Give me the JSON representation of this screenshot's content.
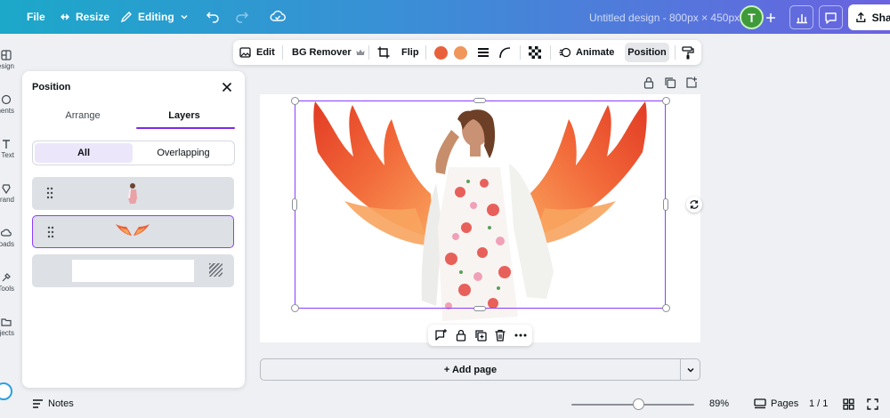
{
  "topbar": {
    "file": "File",
    "resize": "Resize",
    "editing": "Editing",
    "doc_title": "Untitled design - 800px × 450px",
    "avatar_initial": "T",
    "share": "Share"
  },
  "rail": {
    "items": [
      "Design",
      "Elements",
      "Text",
      "Brand",
      "Uploads",
      "Tools",
      "Projects"
    ]
  },
  "panel": {
    "title": "Position",
    "tabs": [
      "Arrange",
      "Layers"
    ],
    "active_tab": "Layers",
    "filter_all": "All",
    "filter_overlapping": "Overlapping",
    "layers": [
      {
        "name": "woman-photo",
        "selected": false
      },
      {
        "name": "wings-graphic",
        "selected": true
      },
      {
        "name": "background",
        "selected": false
      }
    ]
  },
  "context_toolbar": {
    "edit": "Edit",
    "bg_remover": "BG Remover",
    "flip": "Flip",
    "color1": "#e8613a",
    "color2": "#f0965a",
    "animate": "Animate",
    "position": "Position"
  },
  "canvas": {
    "add_page": "+ Add page"
  },
  "bottombar": {
    "notes": "Notes",
    "zoom": "89%",
    "pages": "Pages",
    "page_count": "1 / 1"
  },
  "colors": {
    "accent": "#8b3dff",
    "selection": "#8b3dff"
  }
}
